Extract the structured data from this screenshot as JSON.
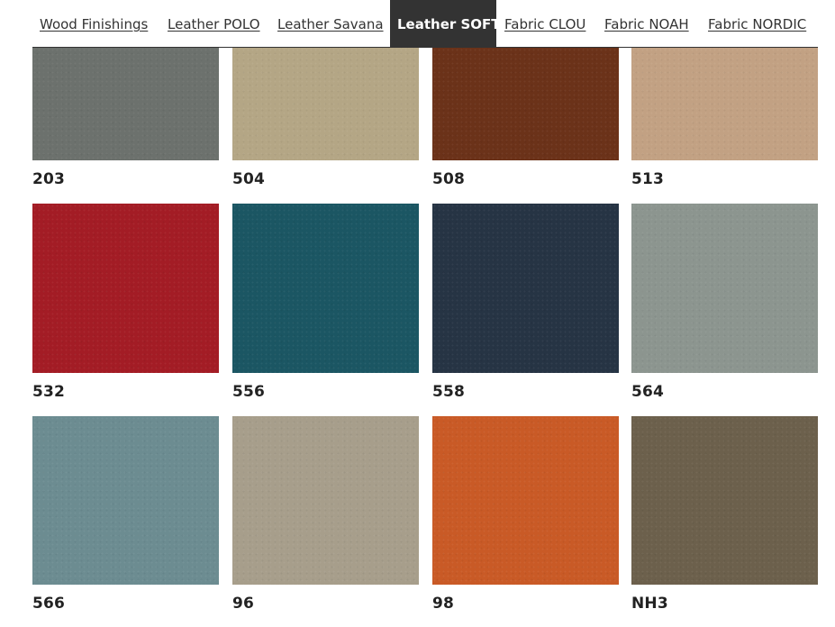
{
  "tabs": [
    {
      "label": "Wood Finishings",
      "active": false
    },
    {
      "label": "Leather POLO",
      "active": false
    },
    {
      "label": "Leather Savana",
      "active": false
    },
    {
      "label": "Leather SOFT",
      "active": true
    },
    {
      "label": "Fabric CLOU",
      "active": false
    },
    {
      "label": "Fabric NOAH",
      "active": false
    },
    {
      "label": "Fabric NORDIC",
      "active": false
    }
  ],
  "swatches": [
    {
      "code": "203",
      "color": "#6c716d"
    },
    {
      "code": "504",
      "color": "#b4a685"
    },
    {
      "code": "508",
      "color": "#6b3219"
    },
    {
      "code": "513",
      "color": "#c2a183"
    },
    {
      "code": "532",
      "color": "#a31c25"
    },
    {
      "code": "556",
      "color": "#1b5663"
    },
    {
      "code": "558",
      "color": "#263444"
    },
    {
      "code": "564",
      "color": "#8c958f"
    },
    {
      "code": "566",
      "color": "#6c8c91"
    },
    {
      "code": "96",
      "color": "#a79e8b"
    },
    {
      "code": "98",
      "color": "#c95a26"
    },
    {
      "code": "NH3",
      "color": "#6c604c"
    }
  ]
}
